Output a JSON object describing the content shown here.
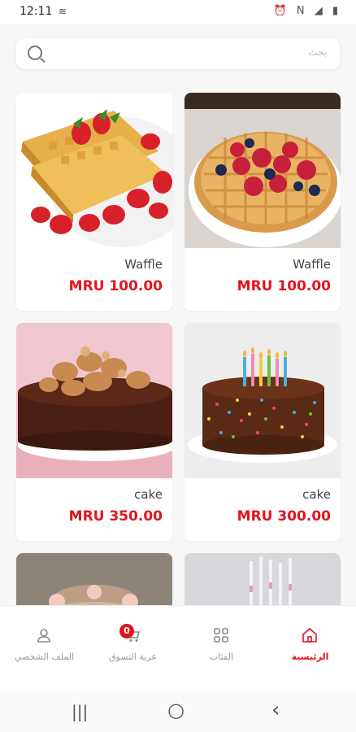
{
  "status": {
    "time": "12:11",
    "left_icon": "wifi-icon",
    "right_icons": "⏰ N ◢ ▮"
  },
  "search": {
    "placeholder": "بحث",
    "icon": "search-icon"
  },
  "products": [
    {
      "name": "Waffle",
      "price": "MRU 100.00",
      "image": "waffle-strawberry"
    },
    {
      "name": "Waffle",
      "price": "MRU 100.00",
      "image": "waffle-berries"
    },
    {
      "name": "cake",
      "price": "MRU 350.00",
      "image": "chocolate-cake"
    },
    {
      "name": "cake",
      "price": "MRU 300.00",
      "image": "birthday-cake-sprinkles"
    },
    {
      "name": "",
      "price": "",
      "image": "happy-birthday-cake"
    },
    {
      "name": "",
      "price": "",
      "image": "candles-cake"
    }
  ],
  "nav": {
    "home": "الرئيسية",
    "categories": "الفئات",
    "cart": "عربة التسوق",
    "cart_count": "0",
    "profile": "الملف الشخصي"
  },
  "system_nav": {
    "recent": "|||",
    "home": "○",
    "back": "‹"
  },
  "colors": {
    "accent": "#e3141b",
    "background": "#f7f7f7"
  }
}
